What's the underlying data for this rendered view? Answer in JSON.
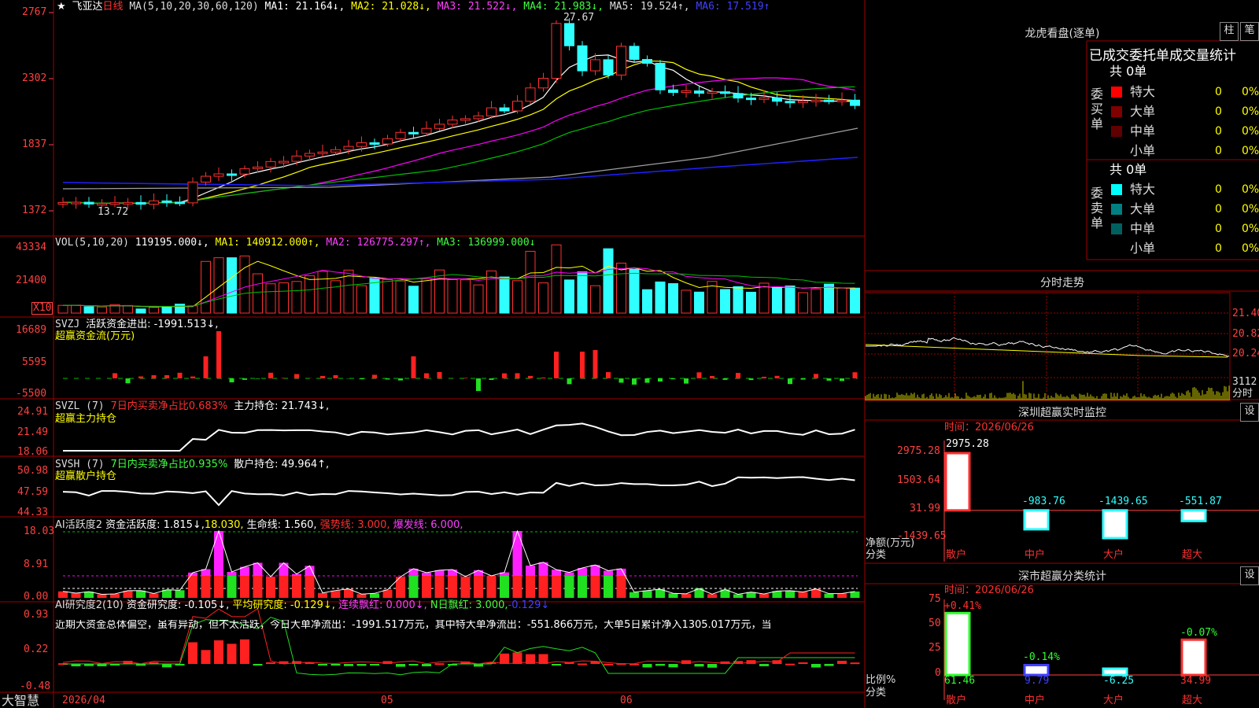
{
  "app": {
    "logo": "大智慧",
    "date_label": "2026/04",
    "month_may": "05",
    "month_jun": "06"
  },
  "colors": {
    "up": "#ff3030",
    "down": "#30ffff",
    "ma1": "#ffffff",
    "ma2": "#ffff00",
    "ma3": "#ff00ff",
    "ma4": "#00ff00",
    "ma5": "#a0a0a0",
    "ma6": "#4040ff",
    "grid": "#8b0000"
  },
  "kline": {
    "title_star": "★",
    "stock_name": "飞亚达",
    "period": "日线",
    "ma_params": "MA(5,10,20,30,60,120)",
    "ma1": "MA1: 21.164↓,",
    "ma2": "MA2: 21.028↓,",
    "ma3": "MA3: 21.522↓,",
    "ma4": "MA4: 21.983↓,",
    "ma5": "MA5: 19.524↑,",
    "ma6": "MA6: 17.519↑",
    "y_labels": [
      "2767",
      "2302",
      "1837",
      "1372"
    ],
    "high_label": "27.67",
    "low_label": "13.72"
  },
  "vol": {
    "name": "VOL(5,10,20)",
    "value": "119195.000↓,",
    "ma1": "MA1: 140912.000↑,",
    "ma2": "MA2: 126775.297↑,",
    "ma3": "MA3: 136999.000↓",
    "y_labels": [
      "43334",
      "21400"
    ],
    "unit": "X10"
  },
  "svzj": {
    "name": "SVZJ",
    "label": "活跃资金进出: -1991.513↓,",
    "subtitle": "超赢资金流(万元)",
    "y_labels": [
      "16689",
      "5595",
      "-5500"
    ]
  },
  "svzl": {
    "name": "SVZL (7)",
    "ratio": "7日内买卖净占比0.683%",
    "hold": "主力持仓: 21.743↓,",
    "subtitle": "超赢主力持仓",
    "y_labels": [
      "24.91",
      "21.49",
      "18.06"
    ]
  },
  "svsh": {
    "name": "SVSH (7)",
    "ratio": "7日内买卖净占比0.935%",
    "hold": "散户持仓: 49.964↑,",
    "subtitle": "超赢散户持仓",
    "y_labels": [
      "50.98",
      "47.59",
      "44.33"
    ]
  },
  "ai1": {
    "name": "AI活跃度2",
    "label1": "资金活跃度: 1.815↓,",
    "label2": "18.030,",
    "label3": "生命线: 1.560,",
    "label4": "强势线: 3.000,",
    "label5": "爆发线: 6.000,",
    "y_labels": [
      "18.03",
      "8.91",
      "0.00"
    ]
  },
  "ai2": {
    "name": "AI研究度2(10)",
    "label1": "资金研究度: -0.105↓,",
    "label2": "平均研究度: -0.129↓,",
    "label3": "连续飘红: 0.000↓,",
    "label4": "N日飘红: 3.000,",
    "label5": "-0.129↓",
    "comment": "近期大资金总体偏空，虽有异动，但不太活跃，今日大单净流出：-1991.517万元，其中特大单净流出：-551.866万元，大单5日累计净入1305.017万元，当",
    "y_labels": [
      "0.93",
      "0.22",
      "-0.48"
    ]
  },
  "lhb": {
    "title": "龙虎看盘(逐单)",
    "btn1": "柱",
    "btn2": "笔",
    "header": "已成交委托单成交量统计",
    "buy_side": "委买单",
    "sell_side": "委卖单",
    "buy_total": "共 0单",
    "sell_total": "共 0单",
    "buy_rows": [
      {
        "label": "特大",
        "count": "0",
        "pct": "0%",
        "color": "#ff0000"
      },
      {
        "label": "大单",
        "count": "0",
        "pct": "0%",
        "color": "#800000"
      },
      {
        "label": "中单",
        "count": "0",
        "pct": "0%",
        "color": "#600000"
      },
      {
        "label": "小单",
        "count": "0",
        "pct": "0%",
        "color": "#000000"
      }
    ],
    "sell_rows": [
      {
        "label": "特大",
        "count": "0",
        "pct": "0%",
        "color": "#00ffff"
      },
      {
        "label": "大单",
        "count": "0",
        "pct": "0%",
        "color": "#008080"
      },
      {
        "label": "中单",
        "count": "0",
        "pct": "0%",
        "color": "#006060"
      },
      {
        "label": "小单",
        "count": "0",
        "pct": "0%",
        "color": "#000000"
      }
    ]
  },
  "fenshi": {
    "title": "分时走势",
    "y_labels": [
      "21.40",
      "20.82",
      "20.24"
    ],
    "vol_label": "3112",
    "unit": "分时"
  },
  "sz_monitor": {
    "title": "深圳超赢实时监控",
    "btn": "设",
    "time": "时间：2026/06/26",
    "y_labels": [
      "2975.28",
      "1503.64",
      "31.99",
      "-1439.65"
    ],
    "y_axis_title": "净额(万元)",
    "x_axis_title": "分类",
    "categories": [
      "散户",
      "中户",
      "大户",
      "超大"
    ],
    "values": [
      "2975.28",
      "-983.76",
      "-1439.65",
      "-551.87"
    ]
  },
  "sz_class": {
    "title": "深市超赢分类统计",
    "btn": "设",
    "time": "时间：2026/06/26",
    "y_labels": [
      "75",
      "50",
      "25",
      "0"
    ],
    "y_axis_title": "比例%",
    "x_axis_title": "分类",
    "categories": [
      "散户",
      "中户",
      "大户",
      "超大"
    ],
    "top_labels": [
      "+0.41%",
      "-0.14%",
      "",
      "-0.07%"
    ],
    "values": [
      "61.46",
      "9.79",
      "-6.25",
      "34.99"
    ]
  },
  "chart_data": {
    "type": "bar",
    "title": "深圳超赢实时监控",
    "categories": [
      "散户",
      "中户",
      "大户",
      "超大"
    ],
    "values": [
      2975.28,
      -983.76,
      -1439.65,
      -551.87
    ],
    "ylabel": "净额(万元)",
    "xlabel": "分类",
    "ylim": [
      -1439.65,
      2975.28
    ]
  }
}
